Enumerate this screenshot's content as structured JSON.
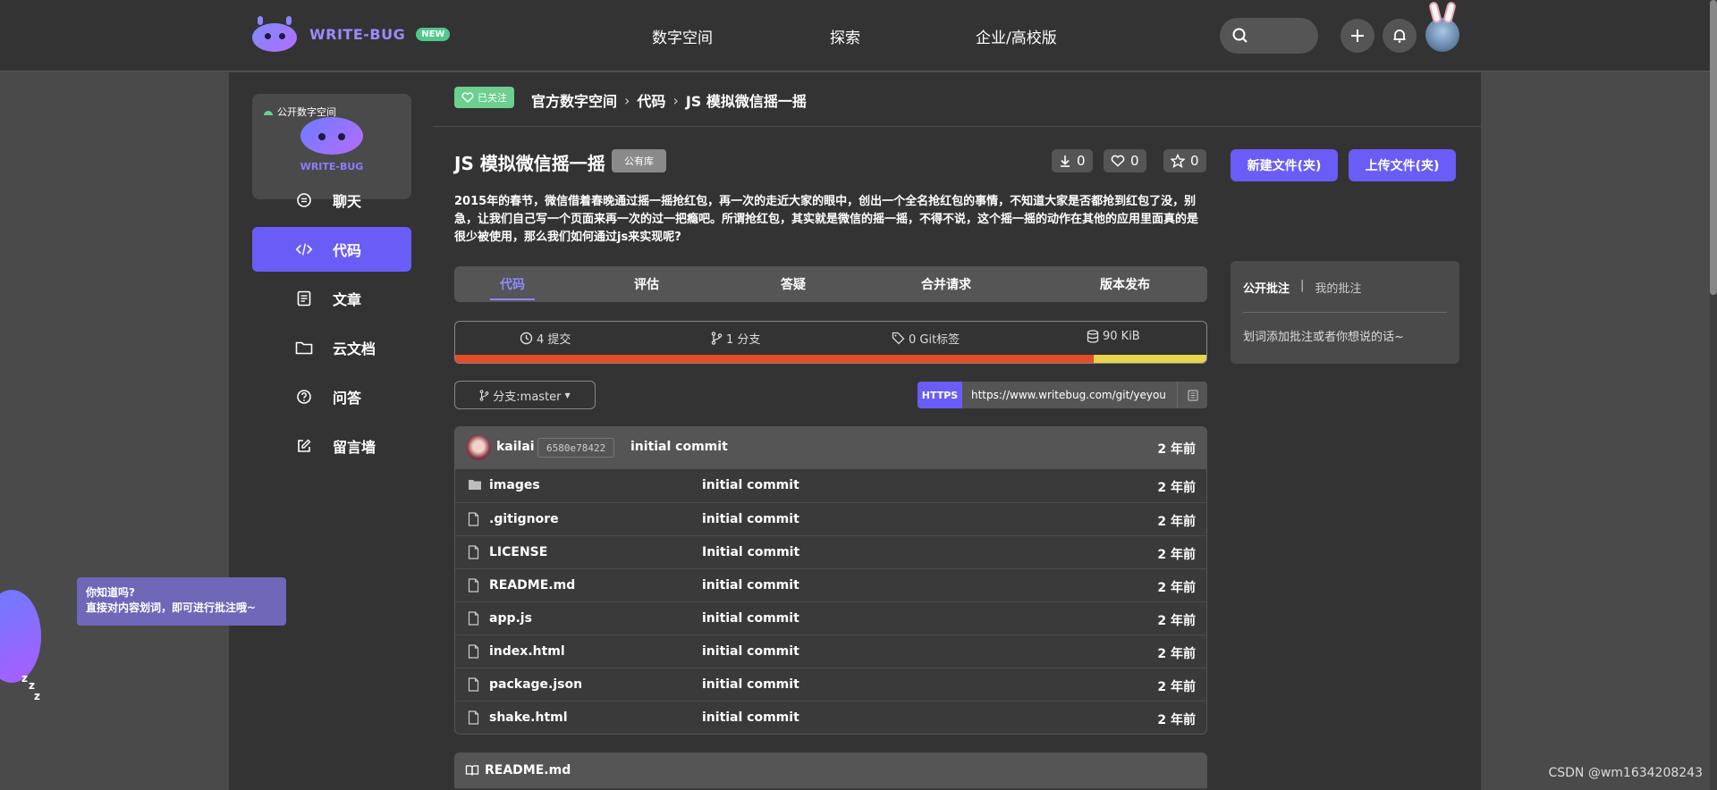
{
  "header": {
    "logo_text": "WRITE-BUG",
    "new_badge": "NEW",
    "nav": [
      "数字空间",
      "探索",
      "企业/高校版"
    ]
  },
  "sidebar": {
    "space_tag": "公开数字空间",
    "space_brand": "WRITE-BUG",
    "items": [
      {
        "label": "聊天",
        "icon": "chat-icon"
      },
      {
        "label": "代码",
        "icon": "code-icon",
        "active": true
      },
      {
        "label": "文章",
        "icon": "article-icon"
      },
      {
        "label": "云文档",
        "icon": "folder-icon"
      },
      {
        "label": "问答",
        "icon": "question-icon"
      },
      {
        "label": "留言墙",
        "icon": "edit-icon"
      }
    ]
  },
  "breadcrumb": {
    "follow_label": "已关注",
    "items": [
      "官方数字空间",
      "代码",
      "JS 模拟微信摇一摇"
    ]
  },
  "repo": {
    "title": "JS 模拟微信摇一摇",
    "visibility": "公有库",
    "downloads": "0",
    "likes": "0",
    "stars": "0",
    "description": "2015年的春节，微信借着春晚通过摇一摇抢红包，再一次的走近大家的眼中，创出一个全名抢红包的事情，不知道大家是否都抢到红包了没，别急，让我们自己写一个页面来再一次的过一把瘾吧。所谓抢红包，其实就是微信的摇一摇，不得不说，这个摇一摇的动作在其他的应用里面真的是很少被使用，那么我们如何通过js来实现呢?"
  },
  "tabs": [
    "代码",
    "评估",
    "答疑",
    "合并请求",
    "版本发布"
  ],
  "stats": {
    "commits": "4 提交",
    "branches": "1 分支",
    "tags": "0 Git标签",
    "size": "90 KiB",
    "languages": [
      {
        "color": "#e34c26",
        "fraction": 0.85
      },
      {
        "color": "#e8d44d",
        "fraction": 0.15
      }
    ]
  },
  "branch": {
    "label": "分支:master"
  },
  "clone": {
    "protocol": "HTTPS",
    "url": "https://www.writebug.com/git/yeyou"
  },
  "latest_commit": {
    "user": "kailai",
    "hash": "6580e78422",
    "message": "initial commit",
    "time": "2 年前"
  },
  "files": [
    {
      "name": "images",
      "type": "folder",
      "message": "initial commit",
      "time": "2 年前"
    },
    {
      "name": ".gitignore",
      "type": "file",
      "message": "initial commit",
      "time": "2 年前"
    },
    {
      "name": "LICENSE",
      "type": "file",
      "message": "Initial commit",
      "time": "2 年前"
    },
    {
      "name": "README.md",
      "type": "file",
      "message": "initial commit",
      "time": "2 年前"
    },
    {
      "name": "app.js",
      "type": "file",
      "message": "initial commit",
      "time": "2 年前"
    },
    {
      "name": "index.html",
      "type": "file",
      "message": "initial commit",
      "time": "2 年前"
    },
    {
      "name": "package.json",
      "type": "file",
      "message": "initial commit",
      "time": "2 年前"
    },
    {
      "name": "shake.html",
      "type": "file",
      "message": "initial commit",
      "time": "2 年前"
    }
  ],
  "readme": {
    "title": "README.md"
  },
  "actions": {
    "new_file": "新建文件(夹)",
    "upload_file": "上传文件(夹)"
  },
  "notes": {
    "tab_public": "公开批注",
    "separator": "|",
    "tab_mine": "我的批注",
    "hint": "划词添加批注或者你想说的话~"
  },
  "tip": {
    "line1": "你知道吗?",
    "line2": "直接对内容划词，即可进行批注哦~"
  },
  "watermark": "CSDN @wm1634208243",
  "colors": {
    "accent": "#6a5cf6",
    "follow": "#6ccf8f",
    "tab_active": "#8e8aff"
  }
}
